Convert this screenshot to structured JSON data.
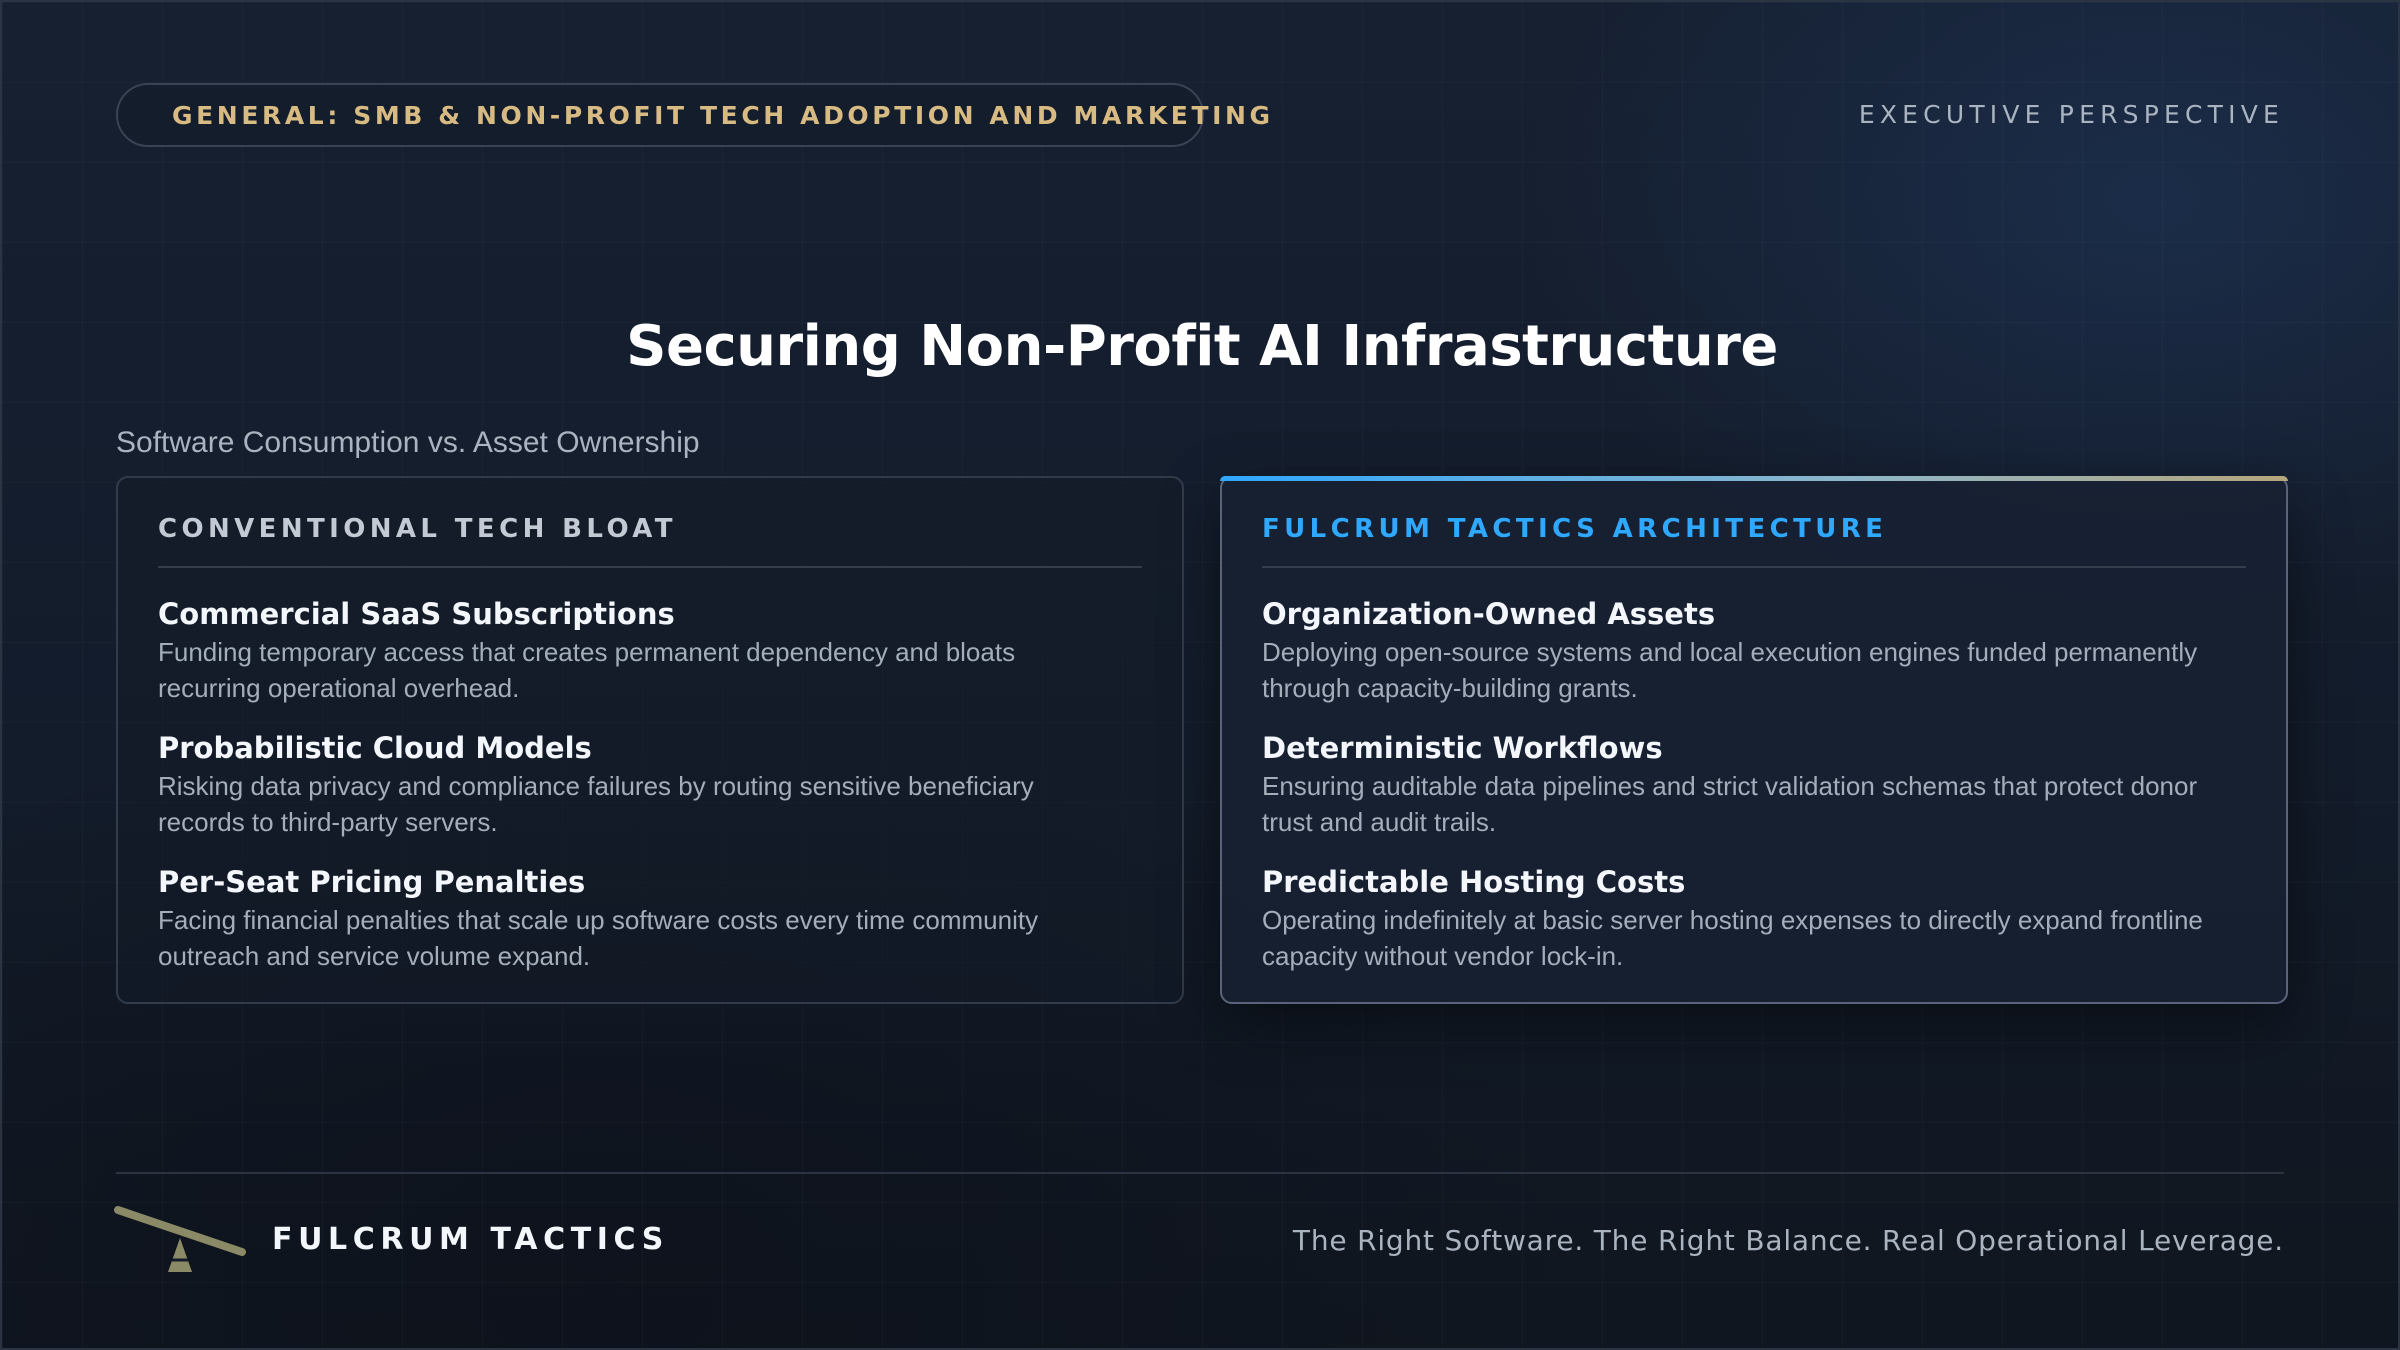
{
  "header": {
    "category": "GENERAL: SMB & NON-PROFIT TECH ADOPTION AND MARKETING",
    "perspective": "EXECUTIVE PERSPECTIVE"
  },
  "title": "Securing Non-Profit AI Infrastructure",
  "subtitle": "Software Consumption vs. Asset Ownership",
  "left_card": {
    "heading": "CONVENTIONAL TECH BLOAT",
    "items": [
      {
        "title": "Commercial SaaS Subscriptions",
        "desc": "Funding temporary access that creates permanent dependency and bloats recurring operational overhead."
      },
      {
        "title": "Probabilistic Cloud Models",
        "desc": "Risking data privacy and compliance failures by routing sensitive beneficiary records to third-party servers."
      },
      {
        "title": "Per-Seat Pricing Penalties",
        "desc": "Facing financial penalties that scale up software costs every time community outreach and service volume expand."
      }
    ]
  },
  "right_card": {
    "heading": "FULCRUM TACTICS ARCHITECTURE",
    "items": [
      {
        "title": "Organization-Owned Assets",
        "desc": "Deploying open-source systems and local execution engines funded permanently through capacity-building grants."
      },
      {
        "title": "Deterministic Workflows",
        "desc": "Ensuring auditable data pipelines and strict validation schemas that protect donor trust and audit trails."
      },
      {
        "title": "Predictable Hosting Costs",
        "desc": "Operating indefinitely at basic server hosting expenses to directly expand frontline capacity without vendor lock-in."
      }
    ]
  },
  "footer": {
    "brand": "FULCRUM TACTICS",
    "tagline": "The Right Software. The Right Balance. Real Operational Leverage.",
    "logo_icon": "fulcrum-seesaw-icon"
  },
  "colors": {
    "accent_blue": "#2fa8ff",
    "accent_gold": "#d8ba83",
    "logo_olive": "#8b8a66",
    "background": "#131b29"
  }
}
